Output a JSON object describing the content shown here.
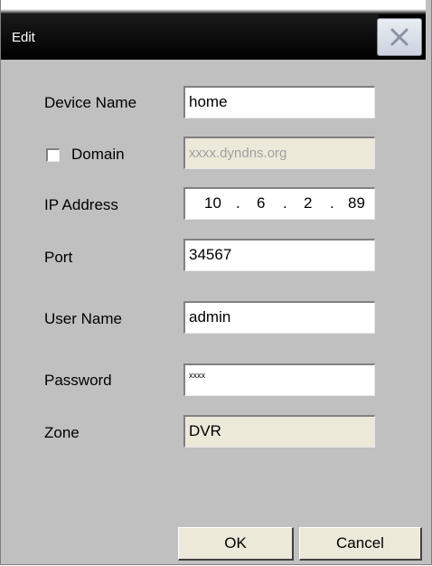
{
  "dialog": {
    "title": "Edit"
  },
  "form": {
    "device_name_label": "Device Name",
    "device_name_value": "home",
    "domain_label": "Domain",
    "domain_checked": false,
    "domain_value": "xxxx.dyndns.org",
    "ip_label": "IP Address",
    "ip_octets": [
      "10",
      "6",
      "2",
      "89"
    ],
    "ip_separator": ".",
    "port_label": "Port",
    "port_value": "34567",
    "user_label": "User Name",
    "user_value": "admin",
    "password_label": "Password",
    "password_value": "xxxx",
    "zone_label": "Zone",
    "zone_value": "DVR"
  },
  "buttons": {
    "ok": "OK",
    "cancel": "Cancel"
  },
  "icons": {
    "close": "close-icon"
  }
}
